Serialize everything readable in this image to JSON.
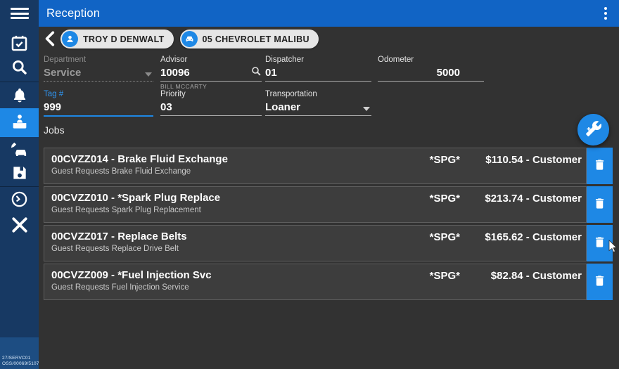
{
  "colors": {
    "accent": "#1e88e5",
    "topbar_blue": "#1164c5",
    "sidebar_navy": "#173963",
    "content_bg": "#323232",
    "row_bg": "#3d3d3d",
    "chip_bg": "#e6e6e6"
  },
  "topbar": {
    "title": "Reception"
  },
  "breadcrumb": {
    "customer": "TROY D DENWALT",
    "vehicle": "05 CHEVROLET MALIBU"
  },
  "form": {
    "department": {
      "label": "Department",
      "value": "Service"
    },
    "advisor": {
      "label": "Advisor",
      "value": "10096",
      "helper": "BILL MCCARTY"
    },
    "dispatcher": {
      "label": "Dispatcher",
      "value": "01"
    },
    "odometer": {
      "label": "Odometer",
      "value": "5000"
    },
    "tag_number": {
      "label": "Tag #",
      "value": "999"
    },
    "priority": {
      "label": "Priority",
      "value": "03"
    },
    "transportation": {
      "label": "Transportation",
      "value": "Loaner"
    }
  },
  "jobs": {
    "label": "Jobs",
    "items": [
      {
        "title": "00CVZZ014 - Brake Fluid Exchange",
        "subtitle": "Guest Requests Brake Fluid Exchange",
        "tag": "*SPG*",
        "price": "$110.54 - Customer"
      },
      {
        "title": "00CVZZ010 - *Spark Plug Replace",
        "subtitle": "Guest Requests Spark Plug Replacement",
        "tag": "*SPG*",
        "price": "$213.74 - Customer"
      },
      {
        "title": "00CVZZ017 - Replace Belts",
        "subtitle": "Guest Requests Replace Drive Belt",
        "tag": "*SPG*",
        "price": "$165.62 - Customer"
      },
      {
        "title": "00CVZZ009 - *Fuel Injection Svc",
        "subtitle": "Guest Requests Fuel Injection Service",
        "tag": "*SPG*",
        "price": "$82.84 - Customer"
      }
    ]
  },
  "sidebar": {
    "icons": [
      "hamburger-menu-icon",
      "appointments-calendar-icon",
      "search-icon",
      "notifications-bell-icon",
      "reception-desk-icon",
      "vehicle-inspection-icon",
      "save-icon",
      "pending-clock-icon",
      "close-icon"
    ],
    "active_item": "reception",
    "status_line1": "27/SERVC01",
    "status_line2": "OSS/00069/5107"
  }
}
